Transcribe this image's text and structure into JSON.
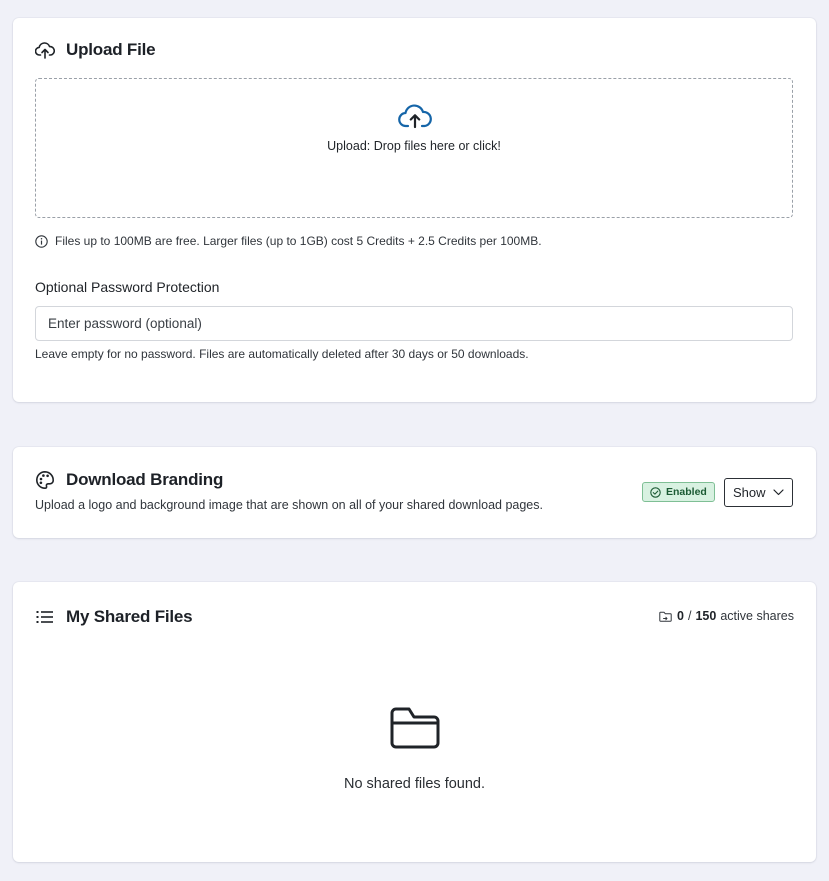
{
  "upload": {
    "title": "Upload File",
    "dropzone_label": "Upload: Drop files here or click!",
    "info": "Files up to 100MB are free. Larger files (up to 1GB) cost 5 Credits + 2.5 Credits per 100MB.",
    "password_label": "Optional Password Protection",
    "password_placeholder": "Enter password (optional)",
    "password_help": "Leave empty for no password. Files are automatically deleted after 30 days or 50 downloads.",
    "icons": [
      "cloud-upload-icon",
      "info-icon"
    ]
  },
  "branding": {
    "title": "Download Branding",
    "description": "Upload a logo and background image that are shown on all of your shared download pages.",
    "status_badge": "Enabled",
    "toggle_label": "Show",
    "icons": [
      "palette-icon",
      "check-circle-icon",
      "chevron-down-icon"
    ]
  },
  "shared": {
    "title": "My Shared Files",
    "active_count": "0",
    "separator": "/",
    "max_count": "150",
    "count_suffix": "active shares",
    "empty_message": "No shared files found.",
    "icons": [
      "list-icon",
      "folder-icon"
    ]
  },
  "colors": {
    "accent": "#1565a8",
    "badge_bg": "#d8f1e1",
    "badge_text": "#1c5a34",
    "page_bg": "#f0f1f8"
  }
}
